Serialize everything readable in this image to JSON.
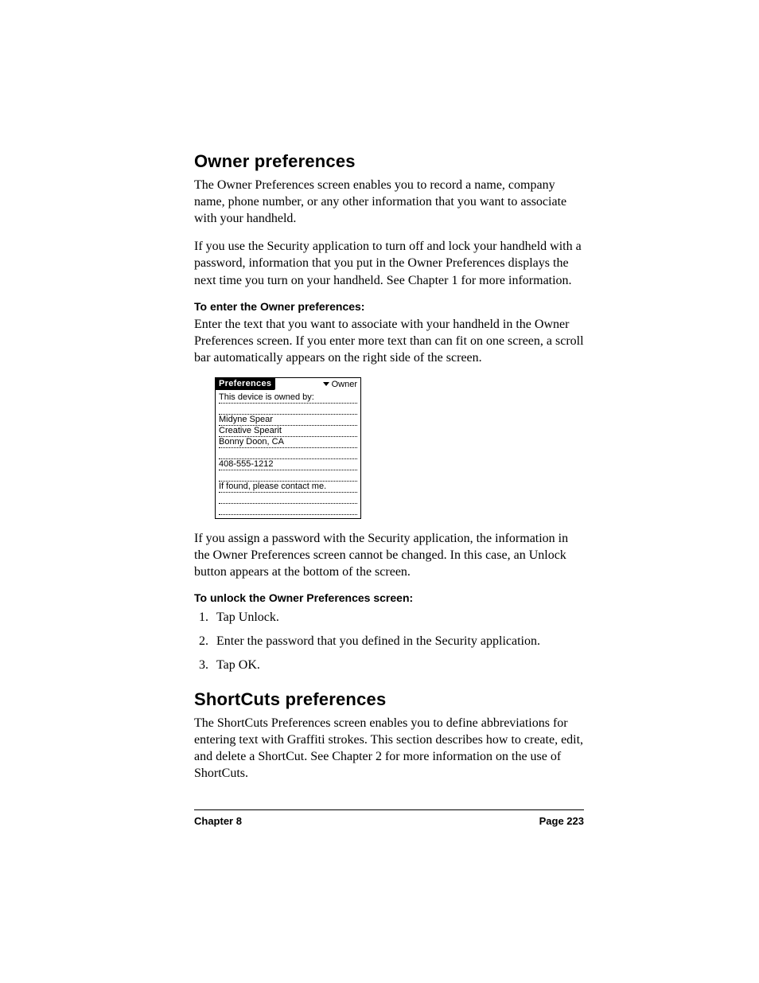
{
  "section1": {
    "heading": "Owner preferences",
    "p1": "The Owner Preferences screen enables you to record a name, company name, phone number, or any other information that you want to associate with your handheld.",
    "p2": "If you use the Security application to turn off and lock your handheld with a password, information that you put in the Owner Preferences displays the next time you turn on your handheld. See Chapter 1 for more information.",
    "sub1": "To enter the Owner preferences:",
    "sub1_body": "Enter the text that you want to associate with your handheld in the Owner Preferences screen. If you enter more text than can fit on one screen, a scroll bar automatically appears on the right side of the screen.",
    "p3": "If you assign a password with the Security application, the information in the Owner Preferences screen cannot be changed. In this case, an Unlock button appears at the bottom of the screen.",
    "sub2": "To unlock the Owner Preferences screen:",
    "steps": [
      "Tap Unlock.",
      "Enter the password that you defined in the Security application.",
      "Tap OK."
    ]
  },
  "screenshot": {
    "title": "Preferences",
    "menu": "Owner",
    "lines": [
      "This device is owned by:",
      "",
      "Midyne Spear",
      "Creative Spearit",
      "Bonny Doon, CA",
      "",
      "408-555-1212",
      "",
      "If found, please contact me.",
      "",
      ""
    ]
  },
  "section2": {
    "heading": "ShortCuts preferences",
    "p1": "The ShortCuts Preferences screen enables you to define abbreviations for entering text with Graffiti strokes. This section describes how to create, edit, and delete a ShortCut. See Chapter 2 for more information on the use of ShortCuts."
  },
  "footer": {
    "left": "Chapter 8",
    "right": "Page 223"
  }
}
